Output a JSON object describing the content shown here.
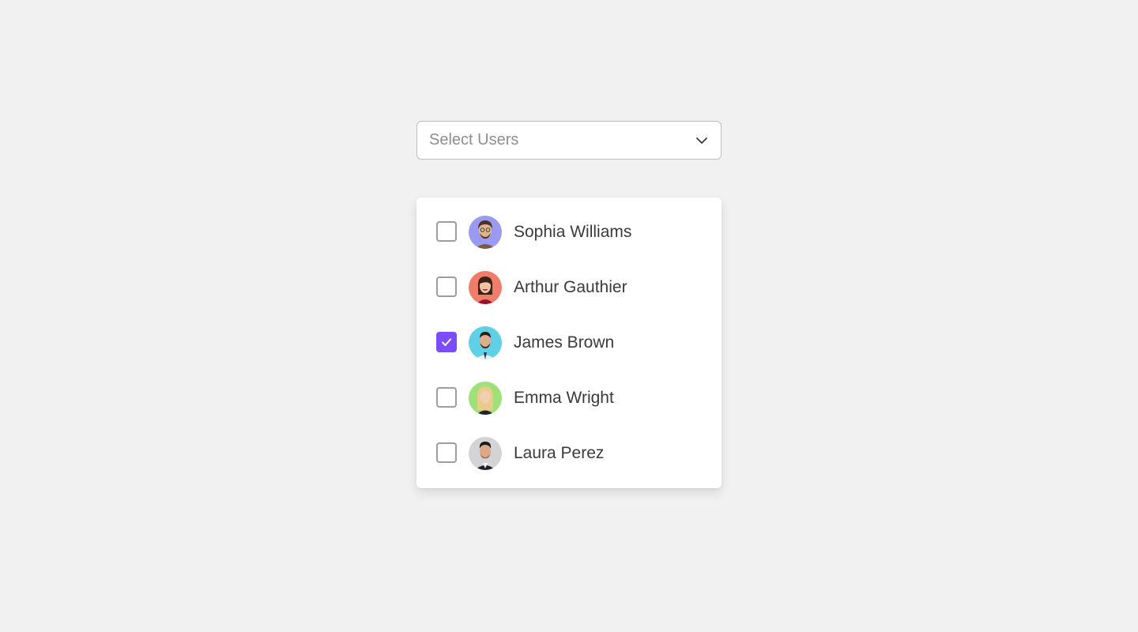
{
  "select": {
    "placeholder": "Select Users",
    "icon": "chevron-down-icon"
  },
  "accent_color": "#7c4dff",
  "users": [
    {
      "name": "Sophia Williams",
      "checked": false,
      "avatar_bg": "#9a9af0"
    },
    {
      "name": "Arthur Gauthier",
      "checked": false,
      "avatar_bg": "#f07c6a"
    },
    {
      "name": "James Brown",
      "checked": true,
      "avatar_bg": "#5fd0e6"
    },
    {
      "name": "Emma Wright",
      "checked": false,
      "avatar_bg": "#9ee07a"
    },
    {
      "name": "Laura Perez",
      "checked": false,
      "avatar_bg": "#d4d4d6"
    }
  ]
}
